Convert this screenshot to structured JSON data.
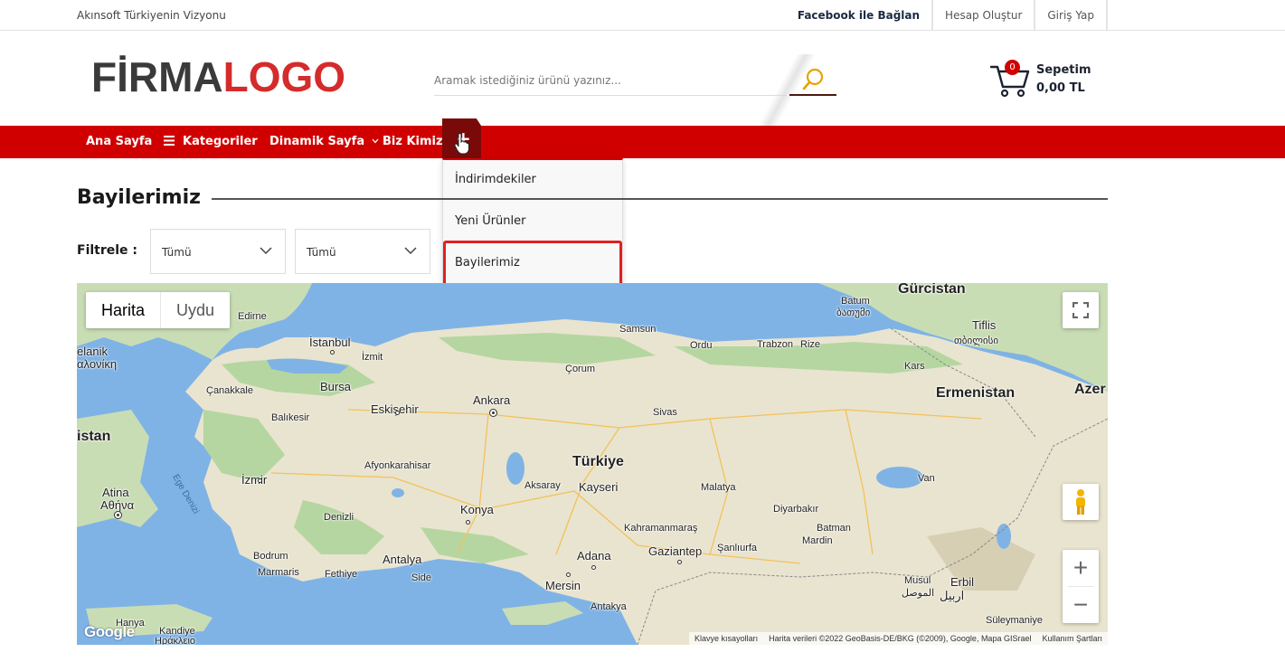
{
  "topbar": {
    "slogan": "Akınsoft Türkiyenin Vizyonu",
    "facebook": "Facebook ile Bağlan",
    "register": "Hesap Oluştur",
    "login": "Giriş Yap"
  },
  "header": {
    "logo_part1": "FİRMA",
    "logo_part2": "LOGO",
    "search_placeholder": "Aramak istediğiniz ürünü yazınız...",
    "cart_count": "0",
    "cart_label": "Sepetim",
    "cart_total": "0,00 TL"
  },
  "nav": {
    "home": "Ana Sayfa",
    "categories": "Kategoriler",
    "dynamic": "Dinamik Sayfa",
    "about": "Biz Kimiz",
    "more": "+"
  },
  "dropdown": {
    "items": [
      "İndirimdekiler",
      "Yeni Ürünler",
      "Bayilerimiz"
    ]
  },
  "page": {
    "title": "Bayilerimiz",
    "filter_label": "Filtrele :",
    "filter1": "Tümü",
    "filter2": "Tümü"
  },
  "map": {
    "type_map": "Harita",
    "type_satellite": "Uydu",
    "zoom_in": "+",
    "zoom_out": "−",
    "google": "Google",
    "attrib_keys": "Klavye kısayolları",
    "attrib_data": "Harita verileri ©2022 GeoBasis-DE/BKG (©2009), Google, Mapa GISrael",
    "attrib_terms": "Kullanım Şartları",
    "labels": {
      "gurcistan": "Gürcistan",
      "batum": "Batum",
      "batum_ka": "ბათუმი",
      "tiflis": "Tiflis",
      "tiflis_ka": "თბილისი",
      "edirne": "Edirne",
      "istanbul": "İstanbul",
      "izmit": "İzmit",
      "samsun": "Samsun",
      "ordu": "Ordu",
      "trabzon": "Trabzon",
      "rize": "Rize",
      "kars": "Kars",
      "selanik": "elanik",
      "selanik_el": "αλονίκη",
      "corum": "Çorum",
      "canakkale": "Çanakkale",
      "bursa": "Bursa",
      "ankara": "Ankara",
      "ermenistan": "Ermenistan",
      "azer": "Azer",
      "balikesir": "Balıkesir",
      "eskisehir": "Eskişehir",
      "sivas": "Sivas",
      "istan": "istan",
      "afyon": "Afyonkarahisar",
      "turkiye": "Türkiye",
      "kayseri": "Kayseri",
      "izmir": "İzmir",
      "aksaray": "Aksaray",
      "malatya": "Malatya",
      "van": "Van",
      "atina": "Atina",
      "atina_el": "Αθήνα",
      "egedenizi": "Ege Denizi",
      "denizli": "Denizli",
      "konya": "Konya",
      "diyarbakir": "Diyarbakır",
      "kahramanmaras": "Kahramanmaraş",
      "batman": "Batman",
      "gaziantep": "Gaziantep",
      "sanliurfa": "Şanlıurfa",
      "mardin": "Mardin",
      "bodrum": "Bodrum",
      "adana": "Adana",
      "marmaris": "Marmaris",
      "fethiye": "Fethiye",
      "antalya": "Antalya",
      "side": "Side",
      "mersin": "Mersin",
      "musul": "Musul",
      "musul_ar": "الموصل",
      "erbil": "Erbil",
      "erbil_ar": "اربيل",
      "hanya": "Hanya",
      "kandiye": "Kandiye",
      "kandiye_el": "Ηράκλειο",
      "antakya": "Antakya",
      "suleymaniye": "Süleymaniye"
    }
  }
}
